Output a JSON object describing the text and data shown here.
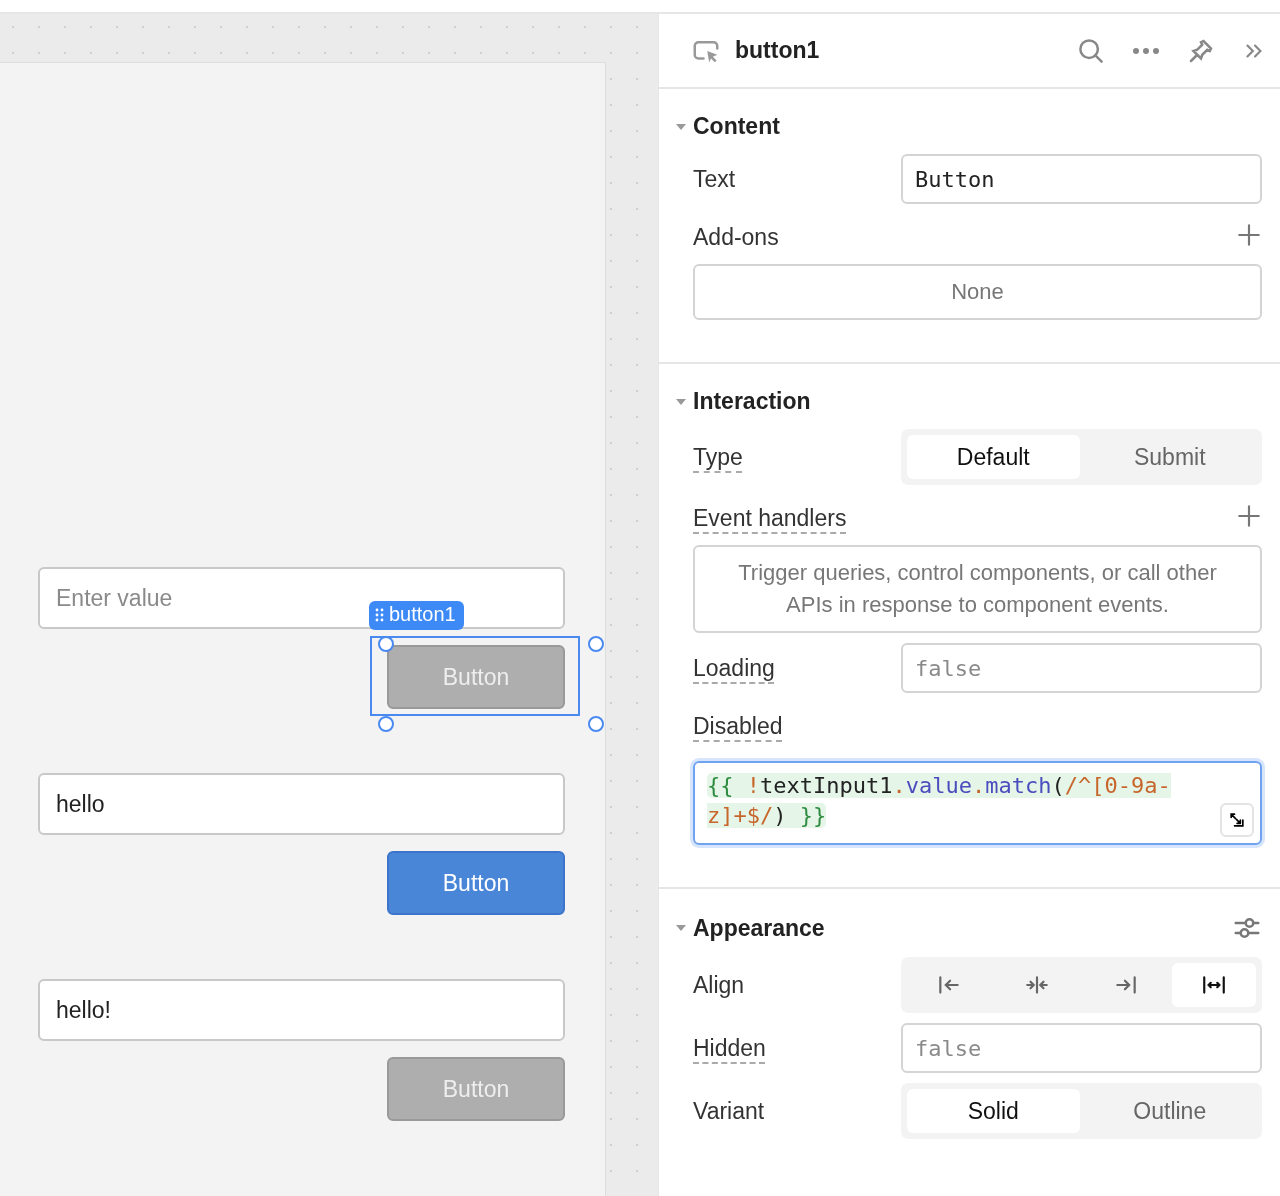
{
  "canvas": {
    "widgets": [
      {
        "kind": "input",
        "placeholder": "Enter value"
      },
      {
        "kind": "button",
        "label": "Button",
        "disabled": true,
        "selected": true,
        "tag": "button1"
      },
      {
        "kind": "input",
        "value": "hello"
      },
      {
        "kind": "button",
        "label": "Button",
        "disabled": false,
        "selected": false
      },
      {
        "kind": "input",
        "value": "hello!"
      },
      {
        "kind": "button",
        "label": "Button",
        "disabled": true,
        "selected": false
      }
    ]
  },
  "inspector": {
    "title": "button1",
    "sections": [
      {
        "title": "Content",
        "expanded": true,
        "settings_button": false,
        "rows": [
          {
            "kind": "field",
            "label": "Text",
            "tooltip": false,
            "value": "Button"
          },
          {
            "kind": "list",
            "label": "Add-ons",
            "tooltip": false,
            "addable": true,
            "empty": "None"
          }
        ]
      },
      {
        "title": "Interaction",
        "expanded": true,
        "settings_button": false,
        "rows": [
          {
            "kind": "segmented",
            "label": "Type",
            "tooltip": true,
            "options": [
              {
                "label": "Default",
                "selected": true
              },
              {
                "label": "Submit",
                "selected": false
              }
            ]
          },
          {
            "kind": "list",
            "label": "Event handlers",
            "tooltip": true,
            "addable": true,
            "empty": "Trigger queries, control components, or call other APIs in response to component events."
          },
          {
            "kind": "field",
            "label": "Loading",
            "tooltip": true,
            "placeholder": "false"
          },
          {
            "kind": "code",
            "label": "Disabled",
            "tooltip": true,
            "focused": true,
            "tokens": [
              {
                "kind": "brace",
                "text": "{{ "
              },
              {
                "kind": "op",
                "text": "!"
              },
              {
                "kind": "ident",
                "text": "textInput1"
              },
              {
                "kind": "op",
                "text": "."
              },
              {
                "kind": "prop",
                "text": "value"
              },
              {
                "kind": "op",
                "text": "."
              },
              {
                "kind": "prop",
                "text": "match"
              },
              {
                "kind": "ident",
                "text": "("
              },
              {
                "kind": "regex",
                "text": "/^[0-9a-z]+$/"
              },
              {
                "kind": "ident",
                "text": ")"
              },
              {
                "kind": "brace",
                "text": " }}"
              }
            ]
          }
        ]
      },
      {
        "title": "Appearance",
        "expanded": true,
        "settings_button": true,
        "rows": [
          {
            "kind": "icon-segmented",
            "label": "Align",
            "tooltip": false,
            "options": [
              {
                "selected": false
              },
              {
                "selected": false
              },
              {
                "selected": false
              },
              {
                "selected": true
              }
            ]
          },
          {
            "kind": "field",
            "label": "Hidden",
            "tooltip": true,
            "placeholder": "false"
          },
          {
            "kind": "segmented",
            "label": "Variant",
            "tooltip": false,
            "options": [
              {
                "label": "Solid",
                "selected": true
              },
              {
                "label": "Outline",
                "selected": false
              }
            ]
          }
        ]
      }
    ]
  }
}
